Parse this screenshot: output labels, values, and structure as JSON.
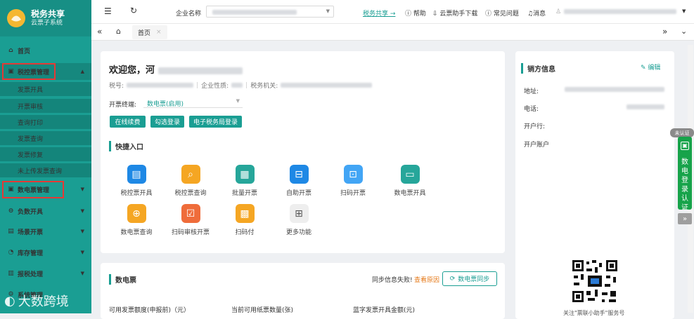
{
  "brand": {
    "title": "税务共享",
    "subtitle": "云票子系统"
  },
  "sidebar": {
    "home": "首页",
    "tax_control": {
      "label": "税控票管理",
      "items": [
        "发票开具",
        "开票审核",
        "查询打印",
        "发票查询",
        "发票修复",
        "未上传发票查询"
      ]
    },
    "digital": "数电票管理",
    "others": [
      "负数开具",
      "场景开票",
      "库存管理",
      "报税处理",
      "系统管理"
    ]
  },
  "watermark": "大数跨境",
  "topbar": {
    "company_label": "企业名称",
    "tax_share_link": "税务共享 →",
    "help": "帮助",
    "download": "云票助手下载",
    "faq": "常见问题",
    "messages": "消息"
  },
  "tabbar": {
    "home_tab": "首页",
    "close": "×"
  },
  "welcome": {
    "greeting": "欢迎您，河",
    "tax_no_label": "税号:",
    "company_type_label": "企业性质:",
    "tax_office_label": "税务机关:",
    "terminal_label": "开票终端:",
    "terminal_value": "数电票(启用)",
    "buttons": [
      "在线续费",
      "勾选登录",
      "电子税务局登录"
    ]
  },
  "quick": {
    "title": "快捷入口",
    "items": [
      {
        "label": "税控票开具",
        "icon": "invoice-issue-icon",
        "color": "#1e88e5"
      },
      {
        "label": "税控票查询",
        "icon": "invoice-search-icon",
        "color": "#f5a623"
      },
      {
        "label": "批量开票",
        "icon": "batch-invoice-icon",
        "color": "#26a69a"
      },
      {
        "label": "自助开票",
        "icon": "self-service-icon",
        "color": "#1e88e5"
      },
      {
        "label": "扫码开票",
        "icon": "scan-icon",
        "color": "#42a5f5"
      },
      {
        "label": "数电票开具",
        "icon": "ticket-icon",
        "color": "#26a69a"
      },
      {
        "label": "数电票查询",
        "icon": "magnifier-icon",
        "color": "#f5a623"
      },
      {
        "label": "扫码审核开票",
        "icon": "scan-review-icon",
        "color": "#ef6c3a"
      },
      {
        "label": "扫码付",
        "icon": "qr-pay-icon",
        "color": "#f5a623"
      },
      {
        "label": "更多功能",
        "icon": "more-grid-icon",
        "color": "#9e9e9e"
      }
    ]
  },
  "digital_card": {
    "title": "数电票",
    "sync_fail": "同步信息失败!",
    "view_reason": "查看原因",
    "sync_button": "数电票同步",
    "stats": [
      "可用发票额度(申报前)（元）",
      "当前可用纸票数量(张)",
      "蓝字发票开具金额(元)"
    ]
  },
  "seller": {
    "title": "销方信息",
    "edit": "编辑",
    "fields": [
      "地址:",
      "电话:",
      "开户行:",
      "开户账户"
    ],
    "qr_caption": "关注\"票联小助手\"服务号"
  },
  "right_float": {
    "badge": "未认证",
    "text": "数电登录认证",
    "expand": "»"
  },
  "colors": {
    "accent": "#1a9e93",
    "sidebar": "#1a9e93",
    "link": "#1a9e93",
    "warn": "#e53935"
  }
}
